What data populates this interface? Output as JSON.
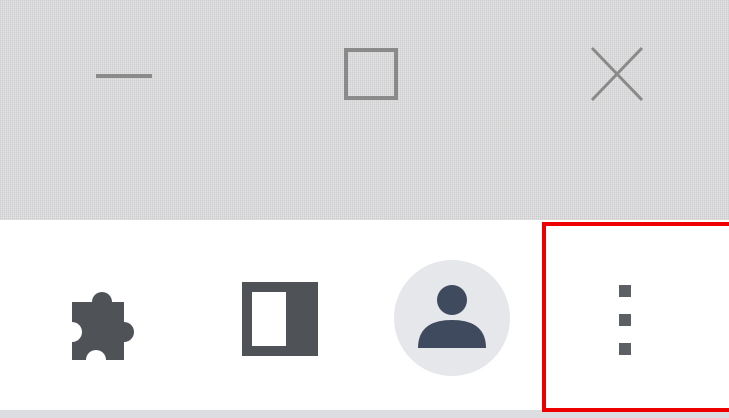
{
  "window_controls": {
    "minimize_icon": "minimize-icon",
    "maximize_icon": "maximize-icon",
    "close_icon": "close-icon"
  },
  "toolbar": {
    "extensions_icon": "puzzle-piece-icon",
    "side_panel_icon": "side-panel-icon",
    "profile_icon": "person-icon",
    "menu_icon": "three-dot-vertical-icon"
  },
  "colors": {
    "titlebar_bg": "#dadadc",
    "icon_gray": "#5f6368",
    "avatar_bg": "#e6e7ea",
    "avatar_fg": "#4a5568",
    "highlight": "#ee0000"
  }
}
